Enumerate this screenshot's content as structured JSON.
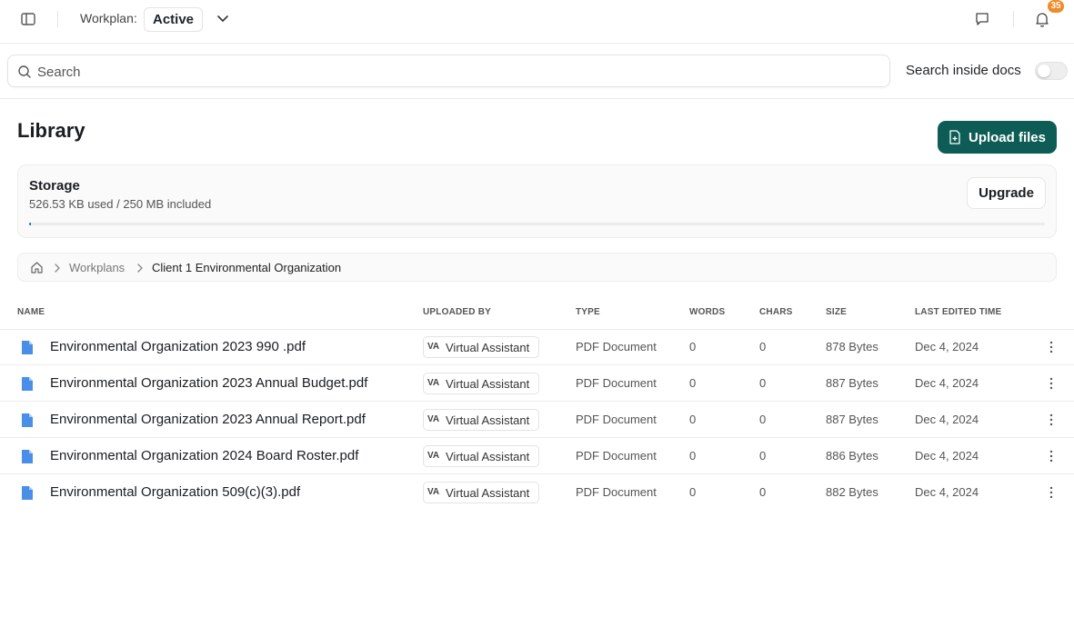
{
  "header": {
    "workplan_label": "Workplan:",
    "workplan_value": "Active",
    "notification_count": "35"
  },
  "search": {
    "placeholder": "Search",
    "inside_docs_label": "Search inside docs",
    "inside_docs_enabled": false
  },
  "library": {
    "title": "Library",
    "upload_label": "Upload files"
  },
  "storage": {
    "title": "Storage",
    "usage_text": "526.53 KB used / 250 MB included",
    "used_fraction": 0.002,
    "upgrade_label": "Upgrade"
  },
  "breadcrumb": {
    "items": [
      "Workplans",
      "Client 1 Environmental Organization"
    ]
  },
  "table": {
    "columns": [
      "NAME",
      "UPLOADED BY",
      "TYPE",
      "WORDS",
      "CHARS",
      "SIZE",
      "LAST EDITED TIME"
    ],
    "rows": [
      {
        "name": "Environmental Organization 2023 990 .pdf",
        "uploader_initials": "VA",
        "uploader": "Virtual Assistant",
        "type": "PDF Document",
        "words": "0",
        "chars": "0",
        "size": "878 Bytes",
        "edited": "Dec 4, 2024"
      },
      {
        "name": "Environmental Organization 2023 Annual Budget.pdf",
        "uploader_initials": "VA",
        "uploader": "Virtual Assistant",
        "type": "PDF Document",
        "words": "0",
        "chars": "0",
        "size": "887 Bytes",
        "edited": "Dec 4, 2024"
      },
      {
        "name": "Environmental Organization 2023 Annual Report.pdf",
        "uploader_initials": "VA",
        "uploader": "Virtual Assistant",
        "type": "PDF Document",
        "words": "0",
        "chars": "0",
        "size": "887 Bytes",
        "edited": "Dec 4, 2024"
      },
      {
        "name": "Environmental Organization 2024 Board Roster.pdf",
        "uploader_initials": "VA",
        "uploader": "Virtual Assistant",
        "type": "PDF Document",
        "words": "0",
        "chars": "0",
        "size": "886 Bytes",
        "edited": "Dec 4, 2024"
      },
      {
        "name": "Environmental Organization 509(c)(3).pdf",
        "uploader_initials": "VA",
        "uploader": "Virtual Assistant",
        "type": "PDF Document",
        "words": "0",
        "chars": "0",
        "size": "882 Bytes",
        "edited": "Dec 4, 2024"
      }
    ]
  },
  "colors": {
    "primary": "#0d5c55",
    "badge": "#f08b2a",
    "file_icon": "#4a8fe7",
    "storage_bar": "#1a6fb0"
  },
  "icons": {
    "sidebar_toggle": "sidebar-panel-icon",
    "workplan_dropdown": "chevron-down-icon",
    "feedback": "message-square-icon",
    "notifications": "bell-icon",
    "search": "search-icon",
    "upload": "file-plus-icon",
    "home": "home-icon",
    "file": "file-icon",
    "row_menu": "more-vertical-icon"
  }
}
